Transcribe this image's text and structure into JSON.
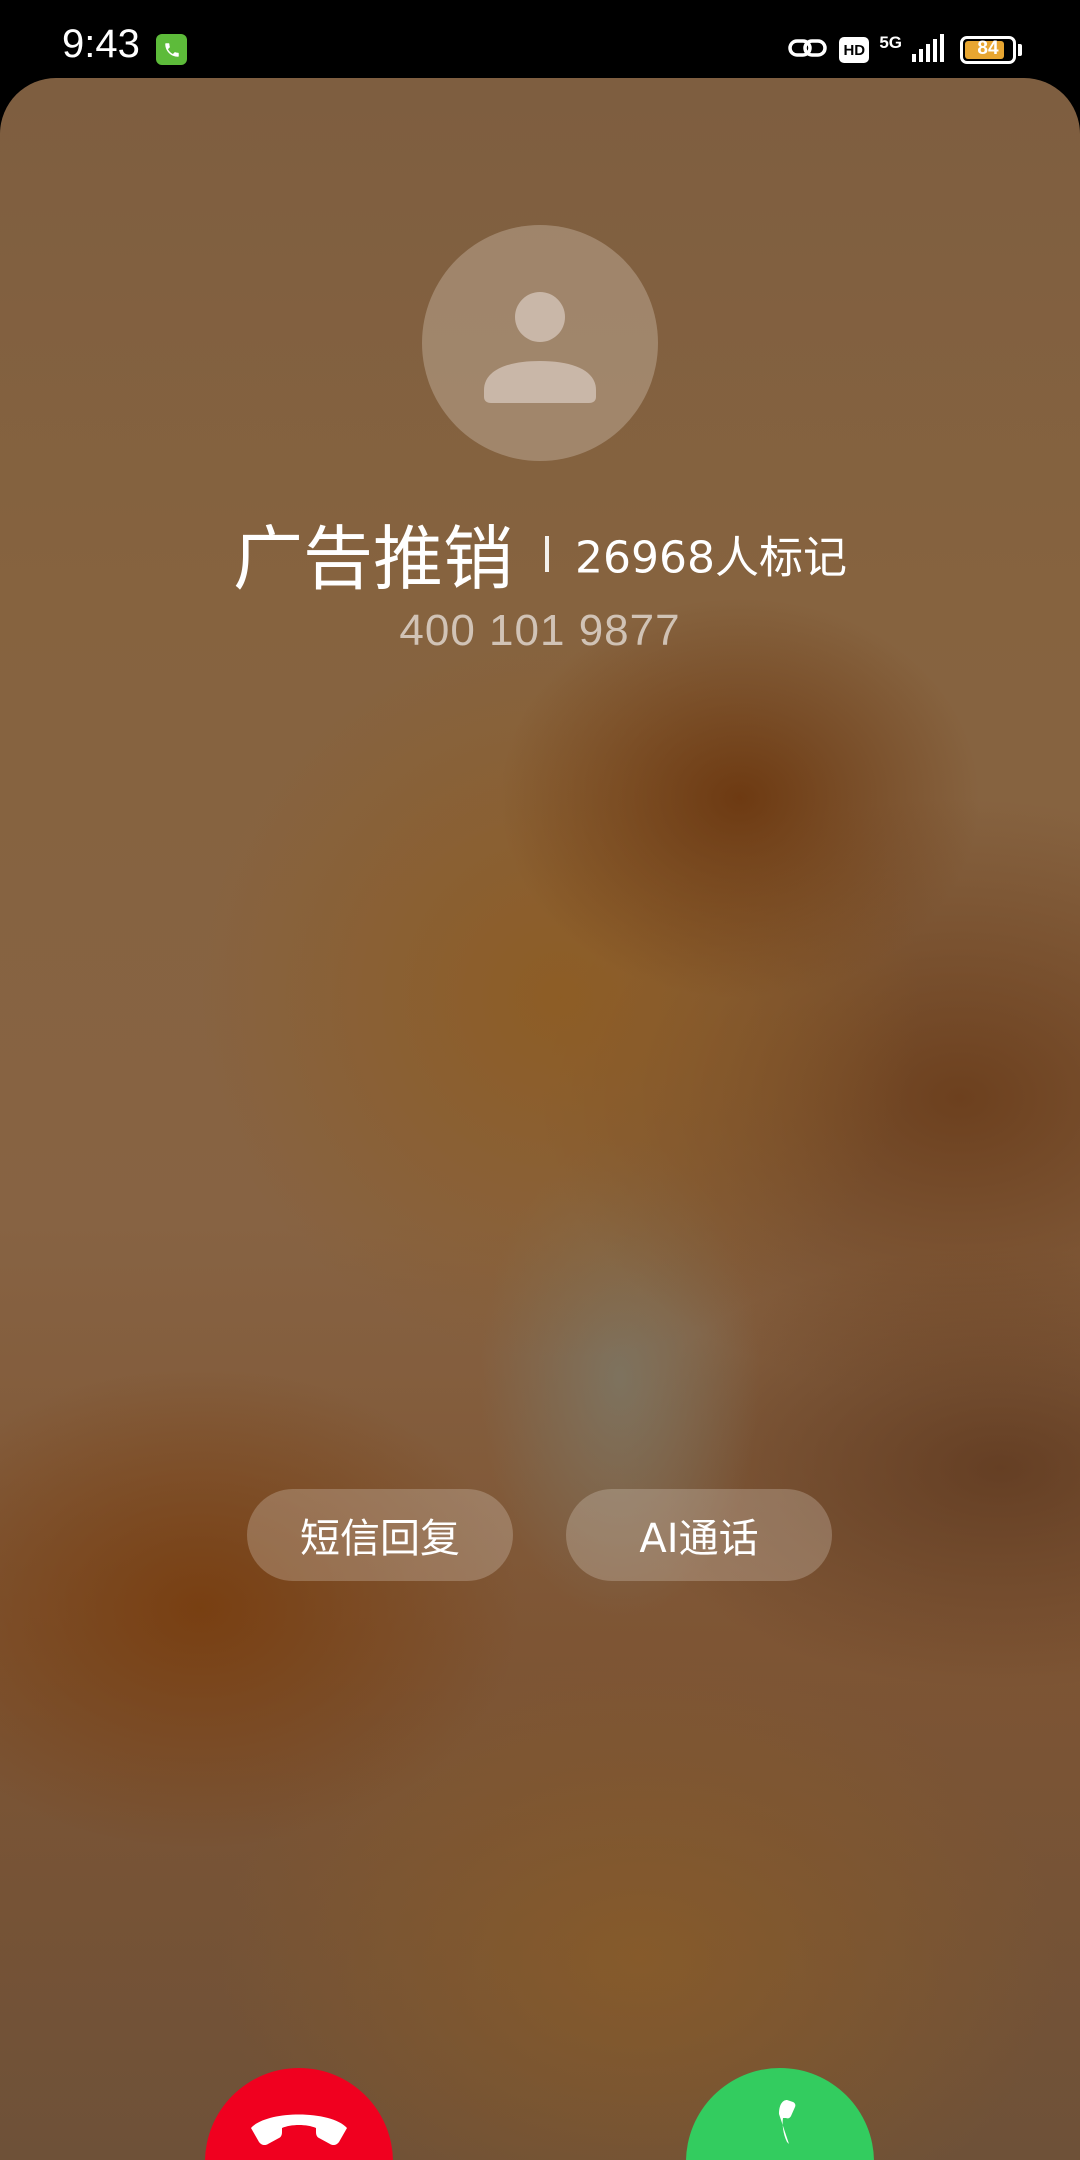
{
  "status_bar": {
    "time": "9:43",
    "network": "5G",
    "hd": "HD",
    "battery": "84",
    "battery_level": 0.84,
    "icons": [
      "call-indicator-icon",
      "link-icon",
      "hd-icon",
      "5g-icon",
      "signal-icon",
      "battery-icon"
    ]
  },
  "caller": {
    "name": "广告推销",
    "marked": "26968人标记",
    "number": "400 101 9877",
    "avatar_icon": "person-icon"
  },
  "actions": {
    "sms_reply": "短信回复",
    "ai_call": "AI通话"
  },
  "buttons": {
    "decline_icon": "hang-up-icon",
    "accept_icon": "phone-icon"
  },
  "colors": {
    "decline": "#f0001f",
    "accept": "#33cc5f",
    "call_indicator": "#5dbb3a",
    "battery": "#e8a631"
  }
}
